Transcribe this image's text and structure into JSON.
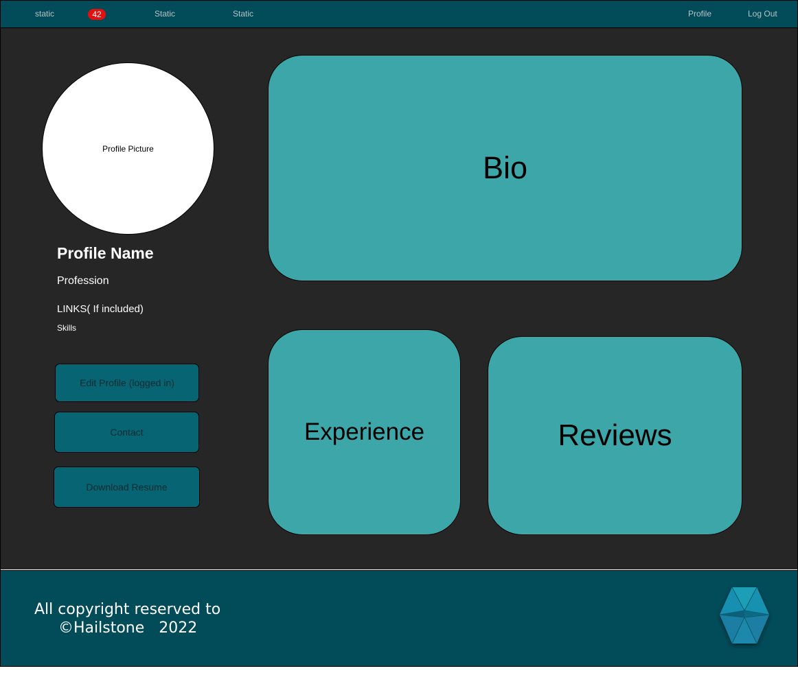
{
  "nav": {
    "item1": "static",
    "badge": "42",
    "item2": "Static",
    "item3": "Static",
    "profile": "Profile",
    "logout": "Log Out"
  },
  "profile": {
    "picture_label": "Profile Picture",
    "name": "Profile Name",
    "profession": "Profession",
    "links": "LINKS( If included)",
    "skills": "Skills"
  },
  "buttons": {
    "edit": "Edit Profile (logged in)",
    "contact": "Contact",
    "download": "Download Resume"
  },
  "cards": {
    "bio": "Bio",
    "experience": "Experience",
    "reviews": "Reviews"
  },
  "footer": {
    "line1": "All copyright reserved to",
    "line2": "©Hailstone   2022"
  },
  "colors": {
    "nav_bg": "#024b59",
    "main_bg": "#262626",
    "card": "#3ca6a8",
    "button": "#076573",
    "badge": "#e31010"
  },
  "icons": {
    "footer_logo": "hexagon-logo-icon"
  }
}
